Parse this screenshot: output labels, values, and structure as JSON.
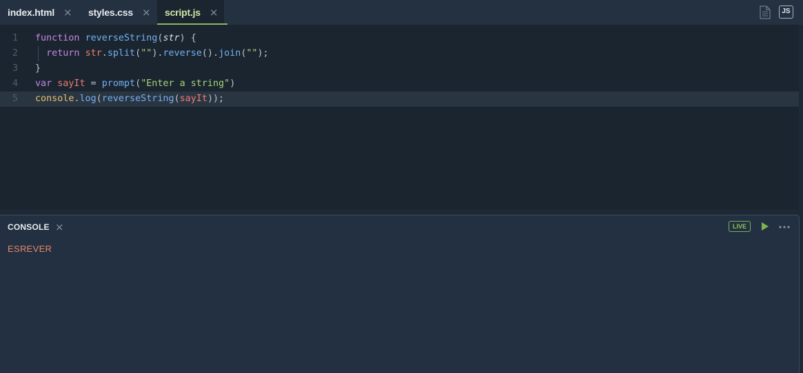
{
  "tabs": [
    {
      "label": "index.html",
      "close": "×"
    },
    {
      "label": "styles.css",
      "close": "×"
    },
    {
      "label": "script.js",
      "close": "×",
      "active": true
    }
  ],
  "header": {
    "file_icon": "document-icon",
    "lang_badge": "JS"
  },
  "editor": {
    "line_numbers": [
      "1",
      "2",
      "3",
      "4",
      "5"
    ],
    "current_line": 5,
    "lines": [
      [
        {
          "t": "function",
          "c": "keyword"
        },
        {
          "t": " ",
          "c": "plain"
        },
        {
          "t": "reverseString",
          "c": "function"
        },
        {
          "t": "(",
          "c": "punct"
        },
        {
          "t": "str",
          "c": "param"
        },
        {
          "t": ") {",
          "c": "punct"
        }
      ],
      [
        {
          "t": "  ",
          "c": "plain"
        },
        {
          "t": "return",
          "c": "keyword"
        },
        {
          "t": " ",
          "c": "plain"
        },
        {
          "t": "str",
          "c": "variable"
        },
        {
          "t": ".",
          "c": "punct"
        },
        {
          "t": "split",
          "c": "function"
        },
        {
          "t": "(",
          "c": "punct"
        },
        {
          "t": "\"\"",
          "c": "string"
        },
        {
          "t": ").",
          "c": "punct"
        },
        {
          "t": "reverse",
          "c": "function"
        },
        {
          "t": "().",
          "c": "punct"
        },
        {
          "t": "join",
          "c": "function"
        },
        {
          "t": "(",
          "c": "punct"
        },
        {
          "t": "\"\"",
          "c": "string"
        },
        {
          "t": ");",
          "c": "punct"
        }
      ],
      [
        {
          "t": "}",
          "c": "punct"
        }
      ],
      [
        {
          "t": "var",
          "c": "keyword"
        },
        {
          "t": " ",
          "c": "plain"
        },
        {
          "t": "sayIt",
          "c": "variable"
        },
        {
          "t": " = ",
          "c": "punct"
        },
        {
          "t": "prompt",
          "c": "function"
        },
        {
          "t": "(",
          "c": "punct"
        },
        {
          "t": "\"Enter a string\"",
          "c": "string"
        },
        {
          "t": ")",
          "c": "punct"
        }
      ],
      [
        {
          "t": "console",
          "c": "object"
        },
        {
          "t": ".",
          "c": "punct"
        },
        {
          "t": "log",
          "c": "function"
        },
        {
          "t": "(",
          "c": "punct"
        },
        {
          "t": "reverseString",
          "c": "function"
        },
        {
          "t": "(",
          "c": "punct"
        },
        {
          "t": "sayIt",
          "c": "variable"
        },
        {
          "t": "));",
          "c": "punct"
        }
      ]
    ]
  },
  "console": {
    "title": "CONSOLE",
    "close": "×",
    "live_badge": "LIVE",
    "run_icon": "play-icon",
    "more_icon": "more-horizontal-icon",
    "output": [
      "ESREVER"
    ]
  },
  "colors": {
    "accent": "#8fb560",
    "output_text": "#e9876a",
    "live": "#8fc25e"
  }
}
